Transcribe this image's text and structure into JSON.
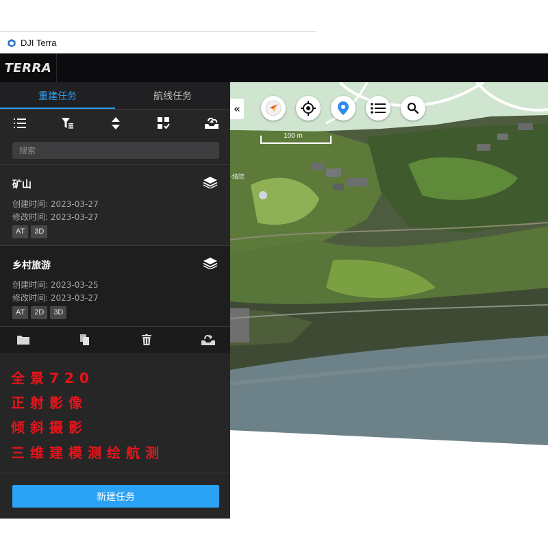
{
  "window": {
    "title": "DJI Terra",
    "app_icon": "dji-terra-app-icon"
  },
  "header": {
    "logo": "TERRA"
  },
  "sidebar": {
    "tabs": [
      {
        "label": "重建任务",
        "active": true
      },
      {
        "label": "航线任务",
        "active": false
      }
    ],
    "toolbar_icons": [
      "list-order-icon",
      "filter-icon",
      "sort-icon",
      "select-all-icon",
      "import-icon"
    ],
    "search": {
      "placeholder": "搜索",
      "value": ""
    },
    "tasks": [
      {
        "name": "矿山",
        "created": "创建时间: 2023-03-27",
        "modified": "修改时间: 2023-03-27",
        "tags": [
          "AT",
          "3D"
        ]
      },
      {
        "name": "乡村旅游",
        "created": "创建时间: 2023-03-25",
        "modified": "修改时间: 2023-03-27",
        "tags": [
          "AT",
          "2D",
          "3D"
        ]
      }
    ],
    "action_icons": [
      "folder-icon",
      "copy-icon",
      "trash-icon",
      "export-icon"
    ],
    "overlay_text": [
      "全景720",
      "正射影像",
      "倾斜摄影",
      "三维建模测绘航测"
    ],
    "new_task_button": "新建任务"
  },
  "map": {
    "collapse": "«",
    "tools": [
      "compass-icon",
      "locate-icon",
      "pin-icon",
      "layers-list-icon",
      "search-icon"
    ],
    "scale_label": "100 m",
    "place_label": "·络院"
  },
  "colors": {
    "accent": "#2d9ff0",
    "button": "#2aa2f5",
    "overlay_red": "#e8141c",
    "sidebar_bg": "#262626"
  }
}
